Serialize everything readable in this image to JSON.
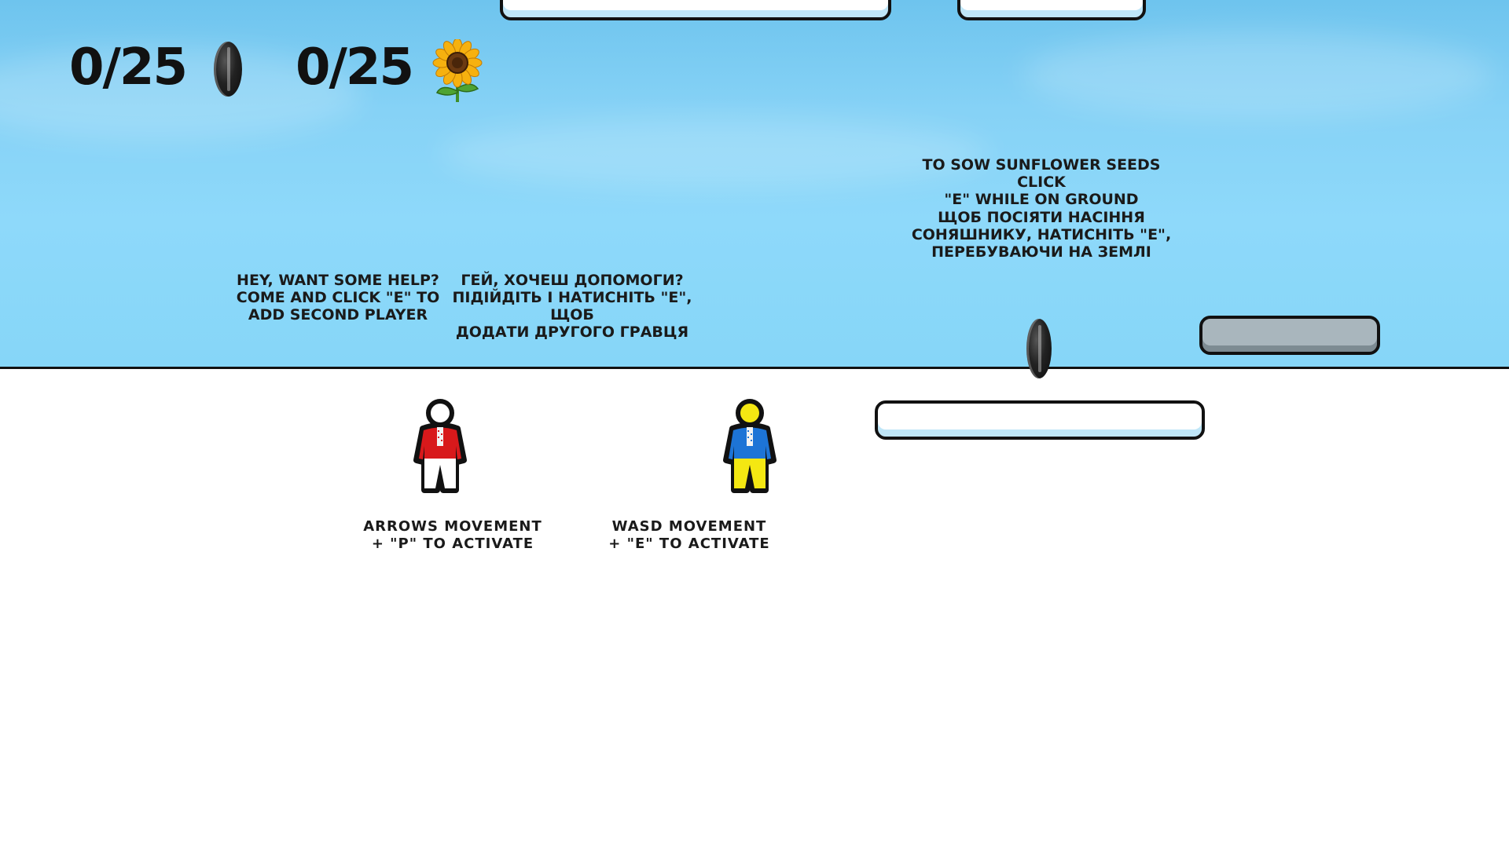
{
  "hud": {
    "seeds_count": "0/25",
    "sunflowers_count": "0/25",
    "seed_icon": "sunflower-seed-icon",
    "sunflower_icon": "sunflower-icon"
  },
  "hints": {
    "help_en": "HEY, WANT SOME HELP?\nCOME AND CLICK \"E\" TO\nADD SECOND PLAYER",
    "help_ua": "ГЕЙ, ХОЧЕШ ДОПОМОГИ?\nПІДІЙДІТЬ І НАТИСНІТЬ \"Е\", ЩОБ\nДОДАТИ ДРУГОГО ГРАВЦЯ",
    "sow_en": "TO SOW SUNFLOWER SEEDS CLICK\n\"E\" WHILE ON GROUND",
    "sow_ua": "ЩОБ ПОСІЯТИ НАСІННЯ\nСОНЯШНИКУ, НАТИСНІТЬ \"Е\",\nПЕРЕБУВАЮЧИ НА ЗЕМЛІ"
  },
  "players": {
    "player_red_controls": "ARROWS MOVEMENT\n+ \"P\" TO ACTIVATE",
    "player_blue_controls": "WASD MOVEMENT\n+ \"E\" TO ACTIVATE",
    "red_color": "#d8191b",
    "blue_color": "#1d74d6",
    "yellow_color": "#f4e712"
  },
  "colors": {
    "sky": "#86d2f6",
    "ground": "#ffffff",
    "platform_shadow": "#bfe6f8",
    "stone": "#a9b6bd"
  }
}
